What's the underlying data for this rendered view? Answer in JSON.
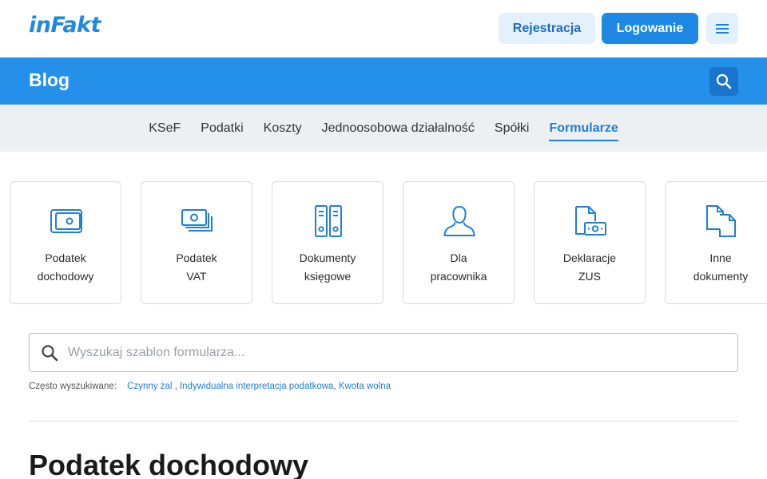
{
  "header": {
    "logo": "inFakt",
    "register_label": "Rejestracja",
    "login_label": "Logowanie",
    "menu_icon": "hamburger-menu-icon"
  },
  "blogbar": {
    "title": "Blog",
    "search_icon": "search-icon"
  },
  "categories": [
    {
      "label": "KSeF",
      "active": false
    },
    {
      "label": "Podatki",
      "active": false
    },
    {
      "label": "Koszty",
      "active": false
    },
    {
      "label": "Jednoosobowa działalność",
      "active": false
    },
    {
      "label": "Spółki",
      "active": false
    },
    {
      "label": "Formularze",
      "active": true
    }
  ],
  "cards": [
    {
      "line1": "Podatek",
      "line2": "dochodowy",
      "icon": "wallet-icon"
    },
    {
      "line1": "Podatek",
      "line2": "VAT",
      "icon": "banknotes-icon"
    },
    {
      "line1": "Dokumenty",
      "line2": "księgowe",
      "icon": "binders-icon"
    },
    {
      "line1": "Dla",
      "line2": "pracownika",
      "icon": "person-icon"
    },
    {
      "line1": "Deklaracje",
      "line2": "ZUS",
      "icon": "document-money-icon"
    },
    {
      "line1": "Inne",
      "line2": "dokumenty",
      "icon": "documents-icon"
    }
  ],
  "search": {
    "placeholder": "Wyszukaj szablon formularza...",
    "value": ""
  },
  "popular": {
    "label": "Często wyszukiwane:",
    "links": [
      "Czynny żal",
      "Indywidualna interpretacja podatkowa",
      "Kwota wolna"
    ]
  },
  "section": {
    "title": "Podatek dochodowy"
  },
  "colors": {
    "accent": "#1e88e5",
    "blogbar": "#2590ea",
    "nav_bg": "#edf0f3"
  }
}
